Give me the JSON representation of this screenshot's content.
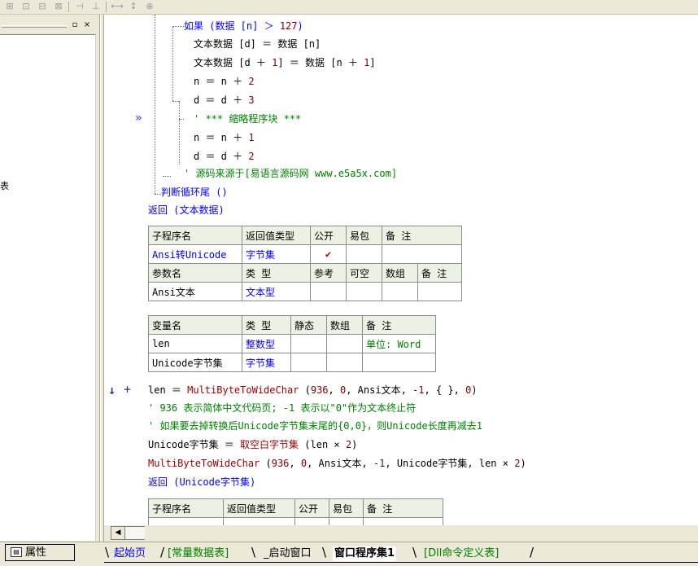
{
  "toolbar": {
    "icons": [
      "align-left-icon",
      "align-center-icon",
      "align-top-icon",
      "align-middle-icon",
      "distribute-h-icon",
      "distribute-v-icon",
      "same-width-icon",
      "same-height-icon",
      "same-size-icon"
    ]
  },
  "left_panel": {
    "minimize_glyph": "▫",
    "close_glyph": "×",
    "cut_text": "表"
  },
  "code_top": [
    {
      "tokens": [
        {
          "t": "如果 (数据 [n] ＞ ",
          "c": "blue"
        },
        {
          "t": "127",
          "c": "num"
        },
        {
          "t": ")",
          "c": "blue"
        }
      ]
    },
    {
      "tokens": [
        {
          "t": "文本数据 [d] ＝ 数据 [n]",
          "c": "black"
        }
      ]
    },
    {
      "tokens": [
        {
          "t": "文本数据 [d ＋ ",
          "c": "black"
        },
        {
          "t": "1",
          "c": "num"
        },
        {
          "t": "] ＝ 数据 [n ＋ ",
          "c": "black"
        },
        {
          "t": "1",
          "c": "num"
        },
        {
          "t": "]",
          "c": "black"
        }
      ]
    },
    {
      "tokens": [
        {
          "t": "n ＝ n ＋ ",
          "c": "black"
        },
        {
          "t": "2",
          "c": "num"
        }
      ]
    },
    {
      "tokens": [
        {
          "t": "d ＝ d ＋ ",
          "c": "black"
        },
        {
          "t": "3",
          "c": "num"
        }
      ]
    },
    {
      "tokens": [
        {
          "t": "' *** 缩略程序块 ***",
          "c": "green"
        }
      ]
    },
    {
      "tokens": [
        {
          "t": "n ＝ n ＋ ",
          "c": "black"
        },
        {
          "t": "1",
          "c": "num"
        }
      ]
    },
    {
      "tokens": [
        {
          "t": "d ＝ d ＋ ",
          "c": "black"
        },
        {
          "t": "2",
          "c": "num"
        }
      ]
    },
    {
      "tokens": [
        {
          "t": "' 源码来源于[易语言源码网 www.e5a5x.com]",
          "c": "green"
        }
      ]
    },
    {
      "tokens": [
        {
          "t": "判断循环尾 ()",
          "c": "blue"
        }
      ]
    },
    {
      "tokens": [
        {
          "t": "返回 (文本数据)",
          "c": "blue"
        }
      ]
    }
  ],
  "sub_table": {
    "header": [
      "子程序名",
      "返回值类型",
      "公开",
      "易包",
      "备 注"
    ],
    "row": [
      "Ansi转Unicode",
      "字节集",
      "✔",
      "",
      ""
    ],
    "param_header": [
      "参数名",
      "类 型",
      "参考",
      "可空",
      "数组",
      "备 注"
    ],
    "param_row": [
      "Ansi文本",
      "文本型",
      "",
      "",
      "",
      ""
    ]
  },
  "var_table": {
    "header": [
      "变量名",
      "类 型",
      "静态",
      "数组",
      "备 注"
    ],
    "rows": [
      [
        "len",
        "整数型",
        "",
        "",
        "单位: Word"
      ],
      [
        "Unicode字节集",
        "字节集",
        "",
        "",
        ""
      ]
    ]
  },
  "code_bottom": [
    {
      "tokens": [
        {
          "t": "len ＝ ",
          "c": "black"
        },
        {
          "t": "MultiByteToWideChar",
          "c": "dred"
        },
        {
          "t": " (",
          "c": "black"
        },
        {
          "t": "936",
          "c": "num"
        },
        {
          "t": ", ",
          "c": "black"
        },
        {
          "t": "0",
          "c": "num"
        },
        {
          "t": ", Ansi文本, ",
          "c": "black"
        },
        {
          "t": "-1",
          "c": "num"
        },
        {
          "t": ", { }, ",
          "c": "black"
        },
        {
          "t": "0",
          "c": "num"
        },
        {
          "t": ")",
          "c": "black"
        }
      ]
    },
    {
      "tokens": [
        {
          "t": "' 936 表示简体中文代码页; -1 表示以\"0\"作为文本终止符",
          "c": "green"
        }
      ]
    },
    {
      "tokens": [
        {
          "t": "' 如果要去掉转换后Unicode字节集末尾的{0,0}，则Unicode长度再减去1",
          "c": "green"
        }
      ]
    },
    {
      "tokens": [
        {
          "t": "Unicode字节集 ＝ ",
          "c": "black"
        },
        {
          "t": "取空白字节集",
          "c": "dred"
        },
        {
          "t": " (len × ",
          "c": "black"
        },
        {
          "t": "2",
          "c": "num"
        },
        {
          "t": ")",
          "c": "black"
        }
      ]
    },
    {
      "tokens": [
        {
          "t": "MultiByteToWideChar",
          "c": "dred"
        },
        {
          "t": " (",
          "c": "black"
        },
        {
          "t": "936",
          "c": "num"
        },
        {
          "t": ", ",
          "c": "black"
        },
        {
          "t": "0",
          "c": "num"
        },
        {
          "t": ", Ansi文本, ",
          "c": "black"
        },
        {
          "t": "-1",
          "c": "num"
        },
        {
          "t": ", Unicode字节集, len × ",
          "c": "black"
        },
        {
          "t": "2",
          "c": "num"
        },
        {
          "t": ")",
          "c": "black"
        }
      ]
    },
    {
      "tokens": [
        {
          "t": "返回 (Unicode字节集)",
          "c": "blue"
        }
      ]
    }
  ],
  "sub_table2": {
    "header": [
      "子程序名",
      "返回值类型",
      "公开",
      "易包",
      "备 注"
    ]
  },
  "gutter": {
    "fold_marker": "»",
    "arrow_marker": "↓",
    "plus_marker": "+"
  },
  "bottom_tabs": {
    "properties_label": "属性",
    "tabs": [
      {
        "label": "起始页",
        "color": "#0000ff",
        "bold": false
      },
      {
        "label": "[常量数据表]",
        "color": "#008000",
        "bold": false
      },
      {
        "label": "_启动窗口",
        "color": "#000000",
        "bold": false
      },
      {
        "label": "窗口程序集1",
        "color": "#000000",
        "bold": true
      },
      {
        "label": "[Dll命令定义表]",
        "color": "#008000",
        "bold": false
      }
    ]
  }
}
